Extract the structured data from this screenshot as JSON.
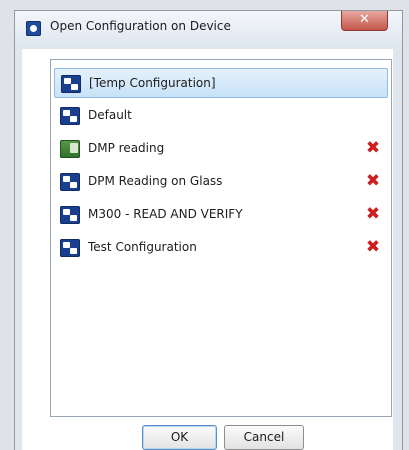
{
  "window": {
    "title": "Open Configuration on Device",
    "close_label": "✕"
  },
  "list": {
    "items": [
      {
        "label": "[Temp Configuration]",
        "icon": "configuration-icon",
        "selected": true,
        "deletable": false
      },
      {
        "label": "Default",
        "icon": "configuration-icon",
        "selected": false,
        "deletable": false
      },
      {
        "label": "DMP reading",
        "icon": "image-configuration-icon",
        "selected": false,
        "deletable": true
      },
      {
        "label": "DPM Reading on Glass",
        "icon": "configuration-icon",
        "selected": false,
        "deletable": true
      },
      {
        "label": "M300 - READ AND VERIFY",
        "icon": "configuration-icon",
        "selected": false,
        "deletable": true
      },
      {
        "label": "Test Configuration",
        "icon": "configuration-icon",
        "selected": false,
        "deletable": true
      }
    ],
    "delete_glyph": "✖"
  },
  "buttons": {
    "ok_label": "OK",
    "cancel_label": "Cancel"
  },
  "colors": {
    "selection": "#c7e2f7",
    "delete": "#cc1f1f",
    "icon_blue": "#1a3f8f"
  }
}
